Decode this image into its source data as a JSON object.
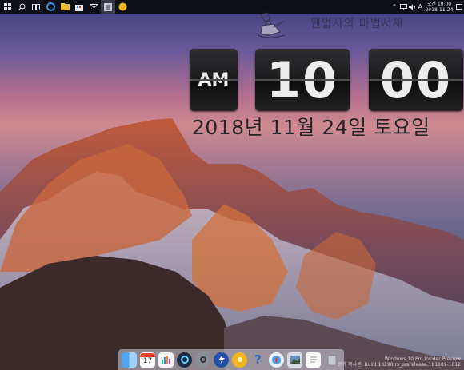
{
  "taskbar": {
    "icons": [
      "windows-start-icon",
      "search-icon",
      "task-view-icon",
      "edge-browser-icon",
      "file-explorer-icon",
      "store-icon",
      "mail-icon",
      "active-app-icon",
      "yellow-app-icon"
    ],
    "tray": {
      "ime_label": "A",
      "clock_time": "오전 10:00",
      "clock_date": "2018-11-24"
    }
  },
  "watermark": {
    "text": "웹법사의 마법서재"
  },
  "flip_clock": {
    "ampm": "AM",
    "hour": "10",
    "minute": "00",
    "date": "2018년 11월 24일 토요일"
  },
  "windows_watermark": {
    "line1": "Windows 10 Pro Insider Preview",
    "line2": "평가 복사본. Build 18290.rs_prerelease.181109-1612"
  },
  "dock": {
    "icons": [
      "finder-icon",
      "calendar-icon",
      "charts-icon",
      "quicktime-icon",
      "settings-icon",
      "safari-like-icon",
      "launchpad-icon",
      "yellow-app-icon",
      "help-icon",
      "compass-icon",
      "photos-icon",
      "notes-icon",
      "trash-icon"
    ],
    "calendar_day": "17"
  },
  "colors": {
    "taskbar_bg": "#0d0f16",
    "flip_card_bg": "#1c1c1e",
    "flip_text": "#ececec",
    "date_text": "#26242b"
  }
}
